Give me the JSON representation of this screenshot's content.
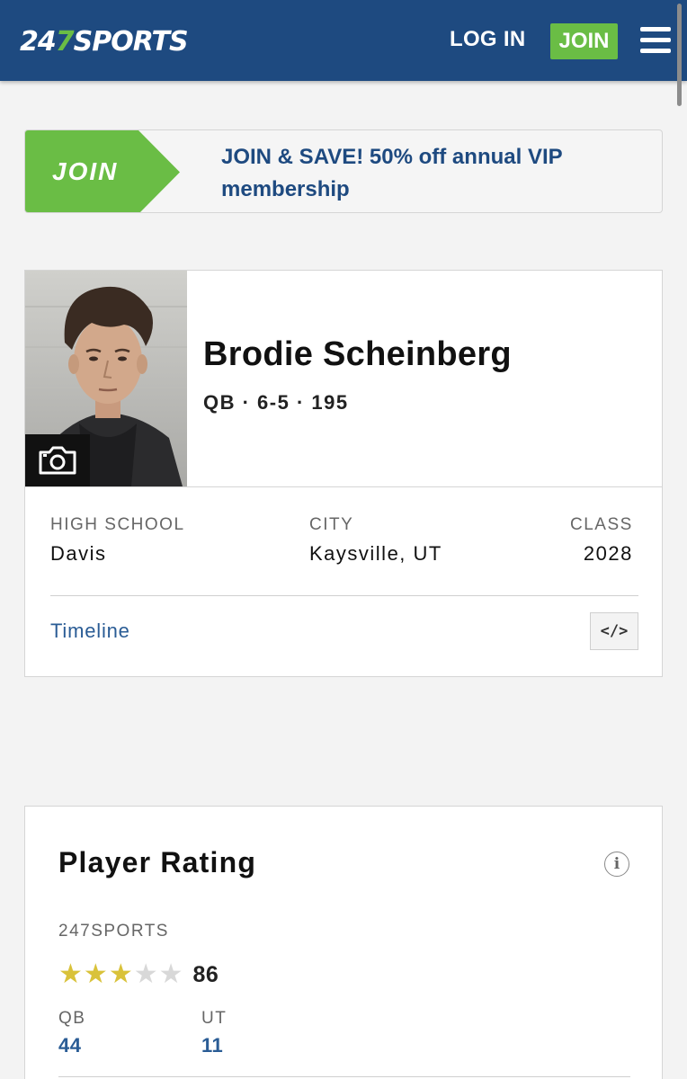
{
  "header": {
    "logo_num_a": "24",
    "logo_num_b": "7",
    "logo_word": "SPORTS",
    "login_label": "LOG IN",
    "join_label": "JOIN"
  },
  "promo": {
    "tag_label": "JOIN",
    "text": "JOIN & SAVE! 50% off annual VIP membership"
  },
  "player": {
    "name": "Brodie Scheinberg",
    "meta": "QB · 6-5 · 195",
    "high_school_label": "HIGH SCHOOL",
    "high_school": "Davis",
    "city_label": "CITY",
    "city": "Kaysville, UT",
    "class_label": "CLASS",
    "class_year": "2028",
    "timeline_label": "Timeline",
    "embed_label": "</>"
  },
  "rating": {
    "title": "Player Rating",
    "source_label": "247SPORTS",
    "stars": 3,
    "stars_max": 5,
    "score": "86",
    "position_label": "QB",
    "position_rank": "44",
    "state_label": "UT",
    "state_rank": "11"
  },
  "colors": {
    "header_blue": "#1e4a80",
    "accent_green": "#6abd45",
    "link_blue": "#2a5c95",
    "star_gold": "#d9c23a"
  },
  "icons": [
    "menu-icon",
    "camera-icon",
    "code-icon",
    "info-icon",
    "star-icon"
  ]
}
